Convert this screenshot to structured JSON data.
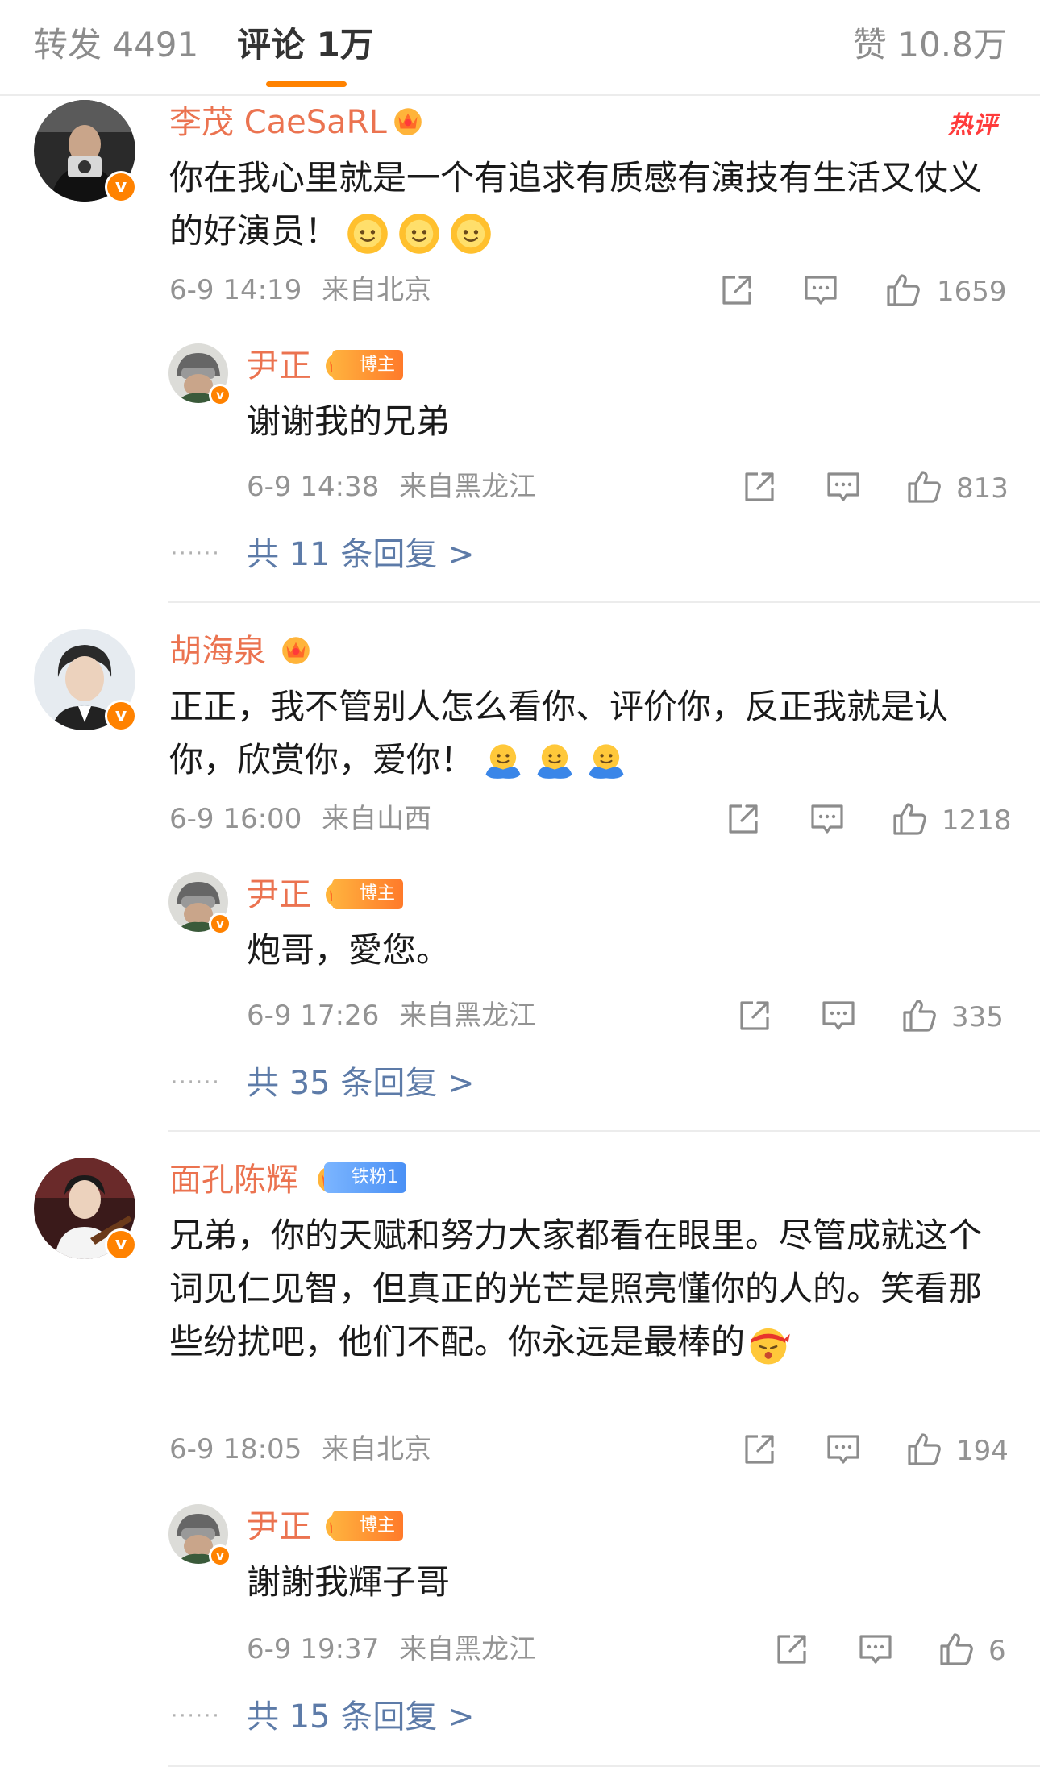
{
  "tabs": {
    "repost": "转发 4491",
    "comments": "评论 1万",
    "likes": "赞 10.8万"
  },
  "hot_label": "热评",
  "comments": [
    {
      "user": "李茂 CaeSaRL",
      "text": "你在我心里就是一个有追求有质感有演技有生活又仗义的好演员！",
      "time": "6-9 14:19",
      "location": "来自北京",
      "likes": "1659",
      "reply": {
        "user": "尹正",
        "tag": "博主",
        "text": "谢谢我的兄弟",
        "time": "6-9 14:38",
        "location": "来自黑龙江",
        "likes": "813"
      },
      "more_replies": "共 11 条回复 >"
    },
    {
      "user": "胡海泉",
      "text": "正正，我不管别人怎么看你、评价你，反正我就是认你，欣赏你，爱你！",
      "time": "6-9 16:00",
      "location": "来自山西",
      "likes": "1218",
      "reply": {
        "user": "尹正",
        "tag": "博主",
        "text": "炮哥，愛您。",
        "time": "6-9 17:26",
        "location": "来自黑龙江",
        "likes": "335"
      },
      "more_replies": "共 35 条回复 >"
    },
    {
      "user": "面孔陈辉",
      "tag": "铁粉1",
      "text": "兄弟，你的天赋和努力大家都看在眼里。尽管成就这个词见仁见智，但真正的光芒是照亮懂你的人的。笑看那些纷扰吧，他们不配。你永远是最棒的",
      "time": "6-9 18:05",
      "location": "来自北京",
      "likes": "194",
      "reply": {
        "user": "尹正",
        "tag": "博主",
        "text": "謝謝我輝子哥",
        "time": "6-9 19:37",
        "location": "来自黑龙江",
        "likes": "6"
      },
      "more_replies": "共 15 条回复 >"
    }
  ],
  "colors": {
    "accent": "#ff8200",
    "username": "#eb7350",
    "link": "#5d7ba8",
    "meta": "#939393"
  }
}
